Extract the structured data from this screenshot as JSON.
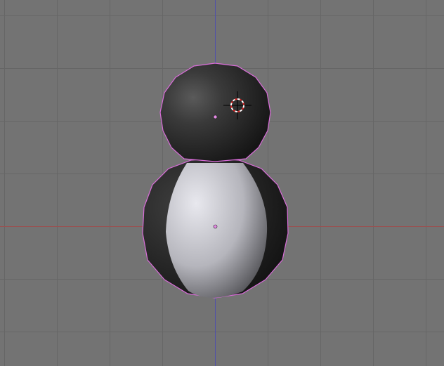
{
  "viewport": {
    "view": "front-orthographic",
    "background_color": "#737373",
    "grid_color": "#666666",
    "x_axis_color": "#9a5050",
    "z_axis_color": "#5050a8",
    "selection_outline_color": "#d96cd9",
    "object_origin_color": "#e58be5",
    "cursor_colors": [
      "#000000",
      "#ffffff",
      "#d42020"
    ]
  },
  "scene": {
    "object": "penguin-mesh",
    "parts": [
      "head",
      "body",
      "belly"
    ],
    "body_color": "#202020",
    "belly_color": "#d6d6dd",
    "selected": true
  },
  "icons": {
    "cursor": "3d-cursor-icon",
    "origin": "object-origin-icon"
  }
}
